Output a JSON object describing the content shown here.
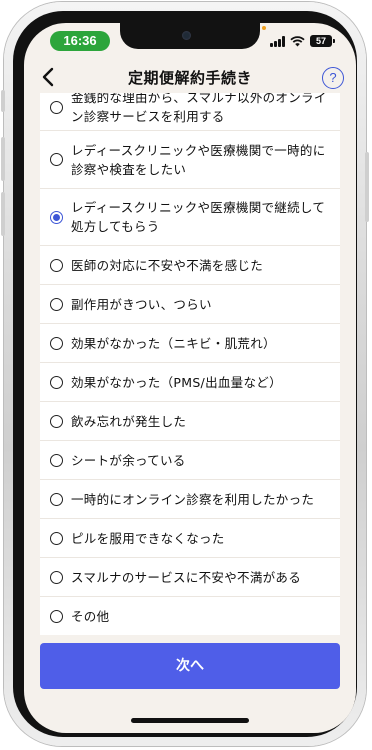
{
  "status_bar": {
    "time": "16:36",
    "battery": "57"
  },
  "header": {
    "title": "定期便解約手続き",
    "help_label": "?"
  },
  "options": [
    {
      "label": "金銭的な理由から、スマルナ以外のオンライン診察サービスを利用する",
      "selected": false
    },
    {
      "label": "レディースクリニックや医療機関で一時的に診察や検査をしたい",
      "selected": false
    },
    {
      "label": "レディースクリニックや医療機関で継続して処方してもらう",
      "selected": true
    },
    {
      "label": "医師の対応に不安や不満を感じた",
      "selected": false
    },
    {
      "label": "副作用がきつい、つらい",
      "selected": false
    },
    {
      "label": "効果がなかった（ニキビ・肌荒れ）",
      "selected": false
    },
    {
      "label": "効果がなかった（PMS/出血量など）",
      "selected": false
    },
    {
      "label": "飲み忘れが発生した",
      "selected": false
    },
    {
      "label": "シートが余っている",
      "selected": false
    },
    {
      "label": "一時的にオンライン診察を利用したかった",
      "selected": false
    },
    {
      "label": "ピルを服用できなくなった",
      "selected": false
    },
    {
      "label": "スマルナのサービスに不安や不満がある",
      "selected": false
    },
    {
      "label": "その他",
      "selected": false
    }
  ],
  "footer": {
    "next_label": "次へ"
  },
  "colors": {
    "accent": "#4f5ee8",
    "radio_selected": "#3d56d6",
    "time_pill": "#2ca53b",
    "screen_bg": "#f5f1ec"
  }
}
